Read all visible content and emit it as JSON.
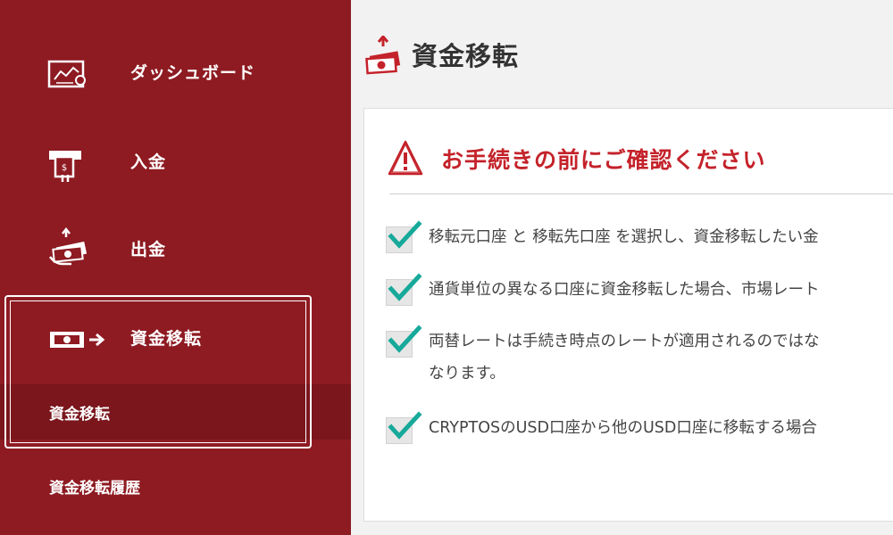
{
  "sidebar": {
    "items": [
      {
        "label": "ダッシュボード",
        "icon": "dashboard-chart-icon"
      },
      {
        "label": "入金",
        "icon": "atm-deposit-icon"
      },
      {
        "label": "出金",
        "icon": "hand-money-withdraw-icon"
      },
      {
        "label": "資金移転",
        "icon": "money-transfer-icon"
      }
    ],
    "sub_items": [
      {
        "label": "資金移転",
        "active": true
      },
      {
        "label": "資金移転履歴",
        "active": false
      }
    ],
    "colors": {
      "background": "#8e1b22",
      "active_sub": "#7a161c"
    }
  },
  "page": {
    "title": "資金移転",
    "title_icon": "money-transfer-up-icon"
  },
  "notice": {
    "title": "お手続きの前にご確認ください",
    "icon": "warning-triangle-icon",
    "accent": "#c4222a",
    "items": [
      "移転元口座 と 移転先口座 を選択し、資金移転したい金",
      "通貨単位の異なる口座に資金移転した場合、市場レート",
      "両替レートは手続き時点のレートが適用されるのではな",
      "なります。",
      "CRYPTOSのUSD口座から他のUSD口座に移転する場合"
    ],
    "check_color": "#17a99a"
  }
}
